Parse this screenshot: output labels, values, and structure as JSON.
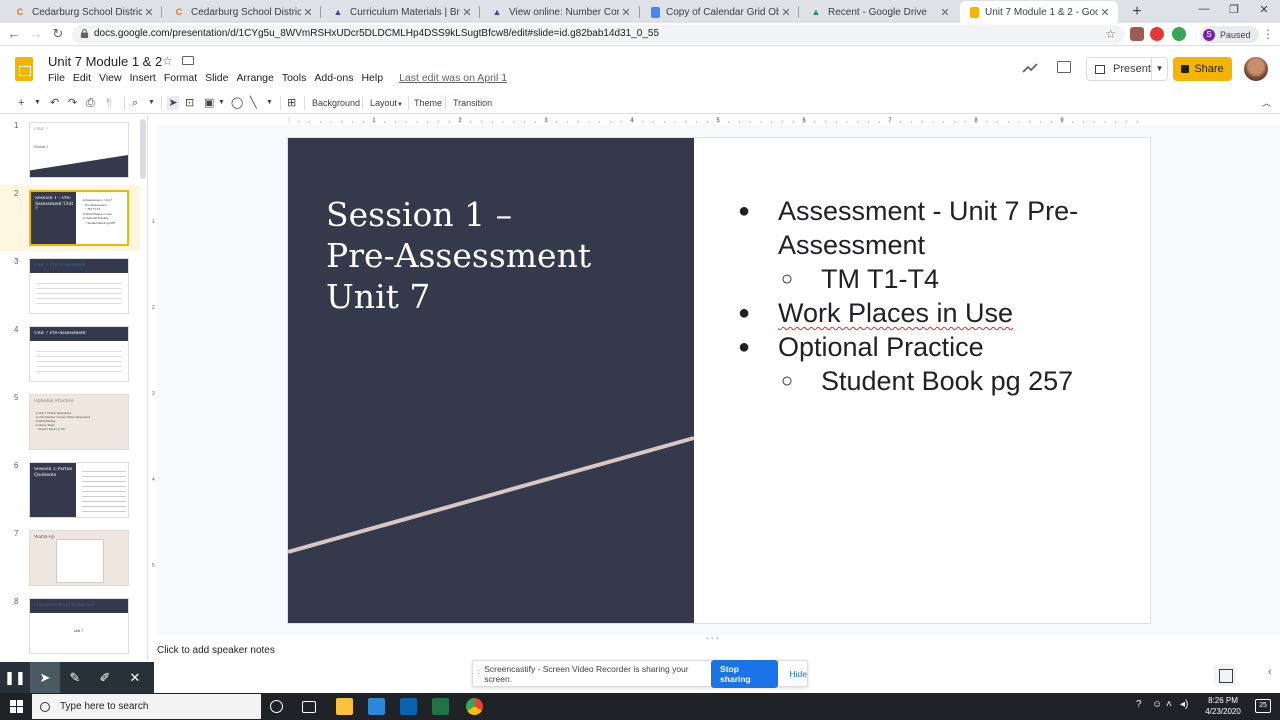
{
  "browser": {
    "tabs": [
      {
        "title": "Cedarburg School District",
        "icon": "c-letter-icon",
        "color": "#e8710a",
        "active": false
      },
      {
        "title": "Cedarburg School District - Staff",
        "icon": "c-letter-icon",
        "color": "#e8710a",
        "active": false
      },
      {
        "title": "Curriculum Materials | Bridges Ed",
        "icon": "bridges-icon",
        "color": "#3949ab",
        "active": false
      },
      {
        "title": "View online: Number Corner Gra",
        "icon": "bridges-icon",
        "color": "#3949ab",
        "active": false
      },
      {
        "title": "Copy of Calendar Grid Observati",
        "icon": "docs-icon",
        "color": "#4285f4",
        "active": false
      },
      {
        "title": "Recent - Google Drive",
        "icon": "drive-icon",
        "color": "#0f9d58",
        "active": false
      },
      {
        "title": "Unit 7 Module 1 & 2 - Google Sli",
        "icon": "slides-icon",
        "color": "#f4b400",
        "active": true
      }
    ],
    "new_tab_symbol": "+",
    "url": "docs.google.com/presentation/d/1CYg5u_8WVmRSHxUDcr5DLDCMLHp4DSS9kLSugtBfcw8/edit#slide=id.g82bab14d31_0_55",
    "profile_label": "Paused",
    "profile_initial": "S"
  },
  "app": {
    "doc_title": "Unit 7 Module 1 & 2",
    "menu": [
      "File",
      "Edit",
      "View",
      "Insert",
      "Format",
      "Slide",
      "Arrange",
      "Tools",
      "Add-ons",
      "Help"
    ],
    "last_edit": "Last edit was on April 1",
    "present_label": "Present",
    "share_label": "Share"
  },
  "toolbar": {
    "background_label": "Background",
    "layout_label": "Layout",
    "theme_label": "Theme",
    "transition_label": "Transition"
  },
  "ruler": {
    "h_numbers": [
      "1",
      "2",
      "3",
      "4",
      "5",
      "6",
      "7",
      "8",
      "9"
    ],
    "v_numbers": [
      "1",
      "2",
      "3",
      "4",
      "5"
    ]
  },
  "filmstrip": {
    "slides": [
      {
        "num": "1",
        "label": "Unit 7",
        "sub": "Module 1"
      },
      {
        "num": "2",
        "label": "Session 1 – Pre-Assessment Unit 7",
        "sub": ""
      },
      {
        "num": "3",
        "label": "Unit 7 Pre-Assessment",
        "sub": ""
      },
      {
        "num": "4",
        "label": "Unit 7 Pre-Assessment",
        "sub": ""
      },
      {
        "num": "5",
        "label": "Optional Practice",
        "sub": ""
      },
      {
        "num": "6",
        "label": "Session 2 Partial Quotients",
        "sub": ""
      },
      {
        "num": "7",
        "label": "Warm-up",
        "sub": ""
      },
      {
        "num": "8",
        "label": "Pre-Assessment Reflection",
        "sub": "Unit 7"
      }
    ]
  },
  "slide": {
    "title_lines": [
      "Session 1 –",
      "Pre-Assessment",
      "Unit 7"
    ],
    "bullets": [
      {
        "text": "Assessment - Unit 7 Pre-Assessment",
        "level": 1
      },
      {
        "text": "TM T1-T4",
        "level": 2
      },
      {
        "text": "Work Places in Use",
        "level": 1
      },
      {
        "text": "Optional Practice",
        "level": 1
      },
      {
        "text": "Student Book pg 257",
        "level": 2
      }
    ],
    "dark_color": "#343a4b",
    "stripe_color": "#d9c8c1"
  },
  "notes": {
    "placeholder": "Click to add speaker notes"
  },
  "screencastify": {
    "banner_text": "Screencastify - Screen Video Recorder is sharing your screen.",
    "stop_label": "Stop sharing",
    "hide_label": "Hide"
  },
  "taskbar": {
    "search_placeholder": "Type here to search",
    "time": "8:26 PM",
    "date": "4/23/2020",
    "notif_count": "25"
  }
}
